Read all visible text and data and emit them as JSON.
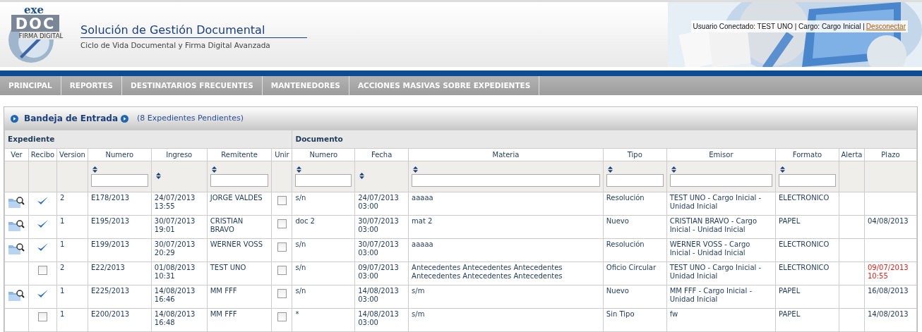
{
  "logo": {
    "top": "exe",
    "main": "DOC",
    "sub": "FIRMA DIGITAL"
  },
  "header": {
    "title": "Solución de Gestión Documental",
    "subtitle": "Ciclo de Vida Documental y Firma Digital Avanzada",
    "user_info": "Usuario Conectado: TEST UNO | Cargo: Cargo Inicial |",
    "logout": "Desconectar"
  },
  "menu": [
    "PRINCIPAL",
    "REPORTES",
    "DESTINATARIOS FRECUENTES",
    "MANTENEDORES",
    "ACCIONES MASIVAS SOBRE EXPEDIENTES"
  ],
  "panel": {
    "title": "Bandeja de Entrada",
    "count": "(8 Expedientes Pendientes)"
  },
  "table": {
    "groups": [
      {
        "label": "Expediente"
      },
      {
        "label": "Documento"
      }
    ],
    "columns": [
      {
        "label": "Ver",
        "sortable": false,
        "filterable": false
      },
      {
        "label": "Recibo",
        "sortable": false,
        "filterable": false
      },
      {
        "label": "Version",
        "sortable": false,
        "filterable": false
      },
      {
        "label": "Numero",
        "sortable": true,
        "filterable": true
      },
      {
        "label": "Ingreso",
        "sortable": true,
        "filterable": false
      },
      {
        "label": "Remitente",
        "sortable": true,
        "filterable": true
      },
      {
        "label": "Unir",
        "sortable": false,
        "filterable": false
      },
      {
        "label": "Numero",
        "sortable": true,
        "filterable": true
      },
      {
        "label": "Fecha",
        "sortable": true,
        "filterable": false
      },
      {
        "label": "Materia",
        "sortable": true,
        "filterable": true
      },
      {
        "label": "Tipo",
        "sortable": true,
        "filterable": true
      },
      {
        "label": "Emisor",
        "sortable": true,
        "filterable": true
      },
      {
        "label": "Formato",
        "sortable": true,
        "filterable": true
      },
      {
        "label": "Alerta",
        "sortable": false,
        "filterable": false
      },
      {
        "label": "Plazo",
        "sortable": false,
        "filterable": false
      }
    ],
    "rows": [
      {
        "viewable": true,
        "received": true,
        "version": "2",
        "numero": "E178/2013",
        "ingreso": "24/07/2013 13:55",
        "remitente": "JORGE VALDES",
        "unir": false,
        "doc_numero": "s/n",
        "fecha": "24/07/2013 03:00",
        "materia": "aaaaa",
        "tipo": "Resolución",
        "emisor": "TEST UNO - Cargo Inicial - Unidad Inicial",
        "formato": "ELECTRONICO"
      },
      {
        "viewable": true,
        "received": true,
        "version": "1",
        "numero": "E195/2013",
        "ingreso": "30/07/2013 19:01",
        "remitente": "CRISTIAN BRAVO",
        "unir": false,
        "doc_numero": "doc 2",
        "fecha": "30/07/2013 03:00",
        "materia": "mat 2",
        "tipo": "Nuevo",
        "emisor": "CRISTIAN BRAVO - Cargo Inicial - Unidad Inicial",
        "formato": "PAPEL",
        "plazo": "04/08/2013",
        "overdue": false
      },
      {
        "viewable": true,
        "received": true,
        "version": "1",
        "numero": "E199/2013",
        "ingreso": "30/07/2013 20:29",
        "remitente": "WERNER VOSS",
        "unir": false,
        "doc_numero": "s/n",
        "fecha": "30/07/2013 03:00",
        "materia": "aaaaa",
        "tipo": "Resolución",
        "emisor": "WERNER VOSS - Cargo Inicial - Unidad Inicial",
        "formato": "ELECTRONICO"
      },
      {
        "viewable": false,
        "received": false,
        "version": "2",
        "numero": "E22/2013",
        "ingreso": "01/08/2013 10:31",
        "remitente": "TEST UNO",
        "unir": false,
        "doc_numero": "s/n",
        "fecha": "09/07/2013 03:00",
        "materia": "Antecedentes Antecedentes Antecedentes Antecedentes Antecedentes Antecedentes",
        "tipo": "Oficio Circular",
        "emisor": "TEST UNO - Cargo Inicial - Unidad Inicial",
        "formato": "ELECTRONICO",
        "plazo": "09/07/2013 10:55",
        "overdue": true
      },
      {
        "viewable": true,
        "received": true,
        "version": "1",
        "numero": "E225/2013",
        "ingreso": "14/08/2013 16:46",
        "remitente": "MM FFF",
        "unir": false,
        "doc_numero": "s/n",
        "fecha": "14/08/2013 03:00",
        "materia": "s/m",
        "tipo": "Nuevo",
        "emisor": "MM FFF - Cargo Inicial - Unidad Inicial",
        "formato": "PAPEL",
        "plazo": "16/08/2013",
        "overdue": false
      },
      {
        "viewable": false,
        "received": false,
        "version": "1",
        "numero": "E200/2013",
        "ingreso": "14/08/2013 16:48",
        "remitente": "MM FFF",
        "unir": false,
        "doc_numero": "*",
        "fecha": "14/08/2013 03:00",
        "materia": "s/m",
        "tipo": "Sin Tipo",
        "emisor": "fw",
        "formato": "PAPEL",
        "plazo": "14/08/2013",
        "overdue": false
      }
    ]
  }
}
